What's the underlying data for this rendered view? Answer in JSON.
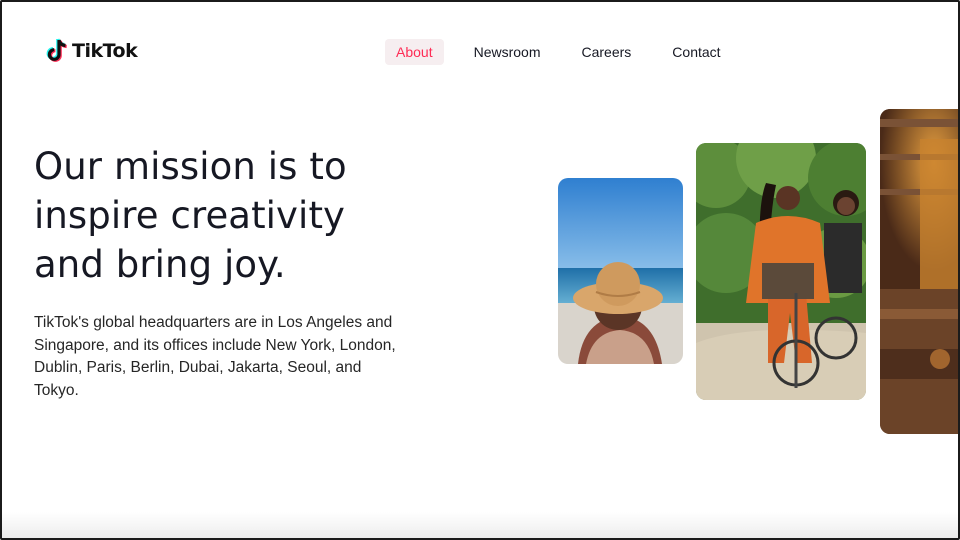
{
  "header": {
    "logo_text": "TikTok",
    "logo_icon": "tiktok-note-icon",
    "nav": [
      {
        "label": "About",
        "active": true
      },
      {
        "label": "Newsroom",
        "active": false
      },
      {
        "label": "Careers",
        "active": false
      },
      {
        "label": "Contact",
        "active": false
      }
    ]
  },
  "hero": {
    "headline_lines": [
      "Our mission is to",
      "inspire creativity",
      "and bring joy."
    ],
    "description": "TikTok's global headquarters are in Los Angeles and Singapore, and its offices include New York, London, Dublin, Paris, Berlin, Dubai, Jakarta, Seoul, and Tokyo."
  },
  "colors": {
    "accent": "#fe2c55",
    "active_nav_bg": "#f6eef0",
    "text": "#161823"
  }
}
